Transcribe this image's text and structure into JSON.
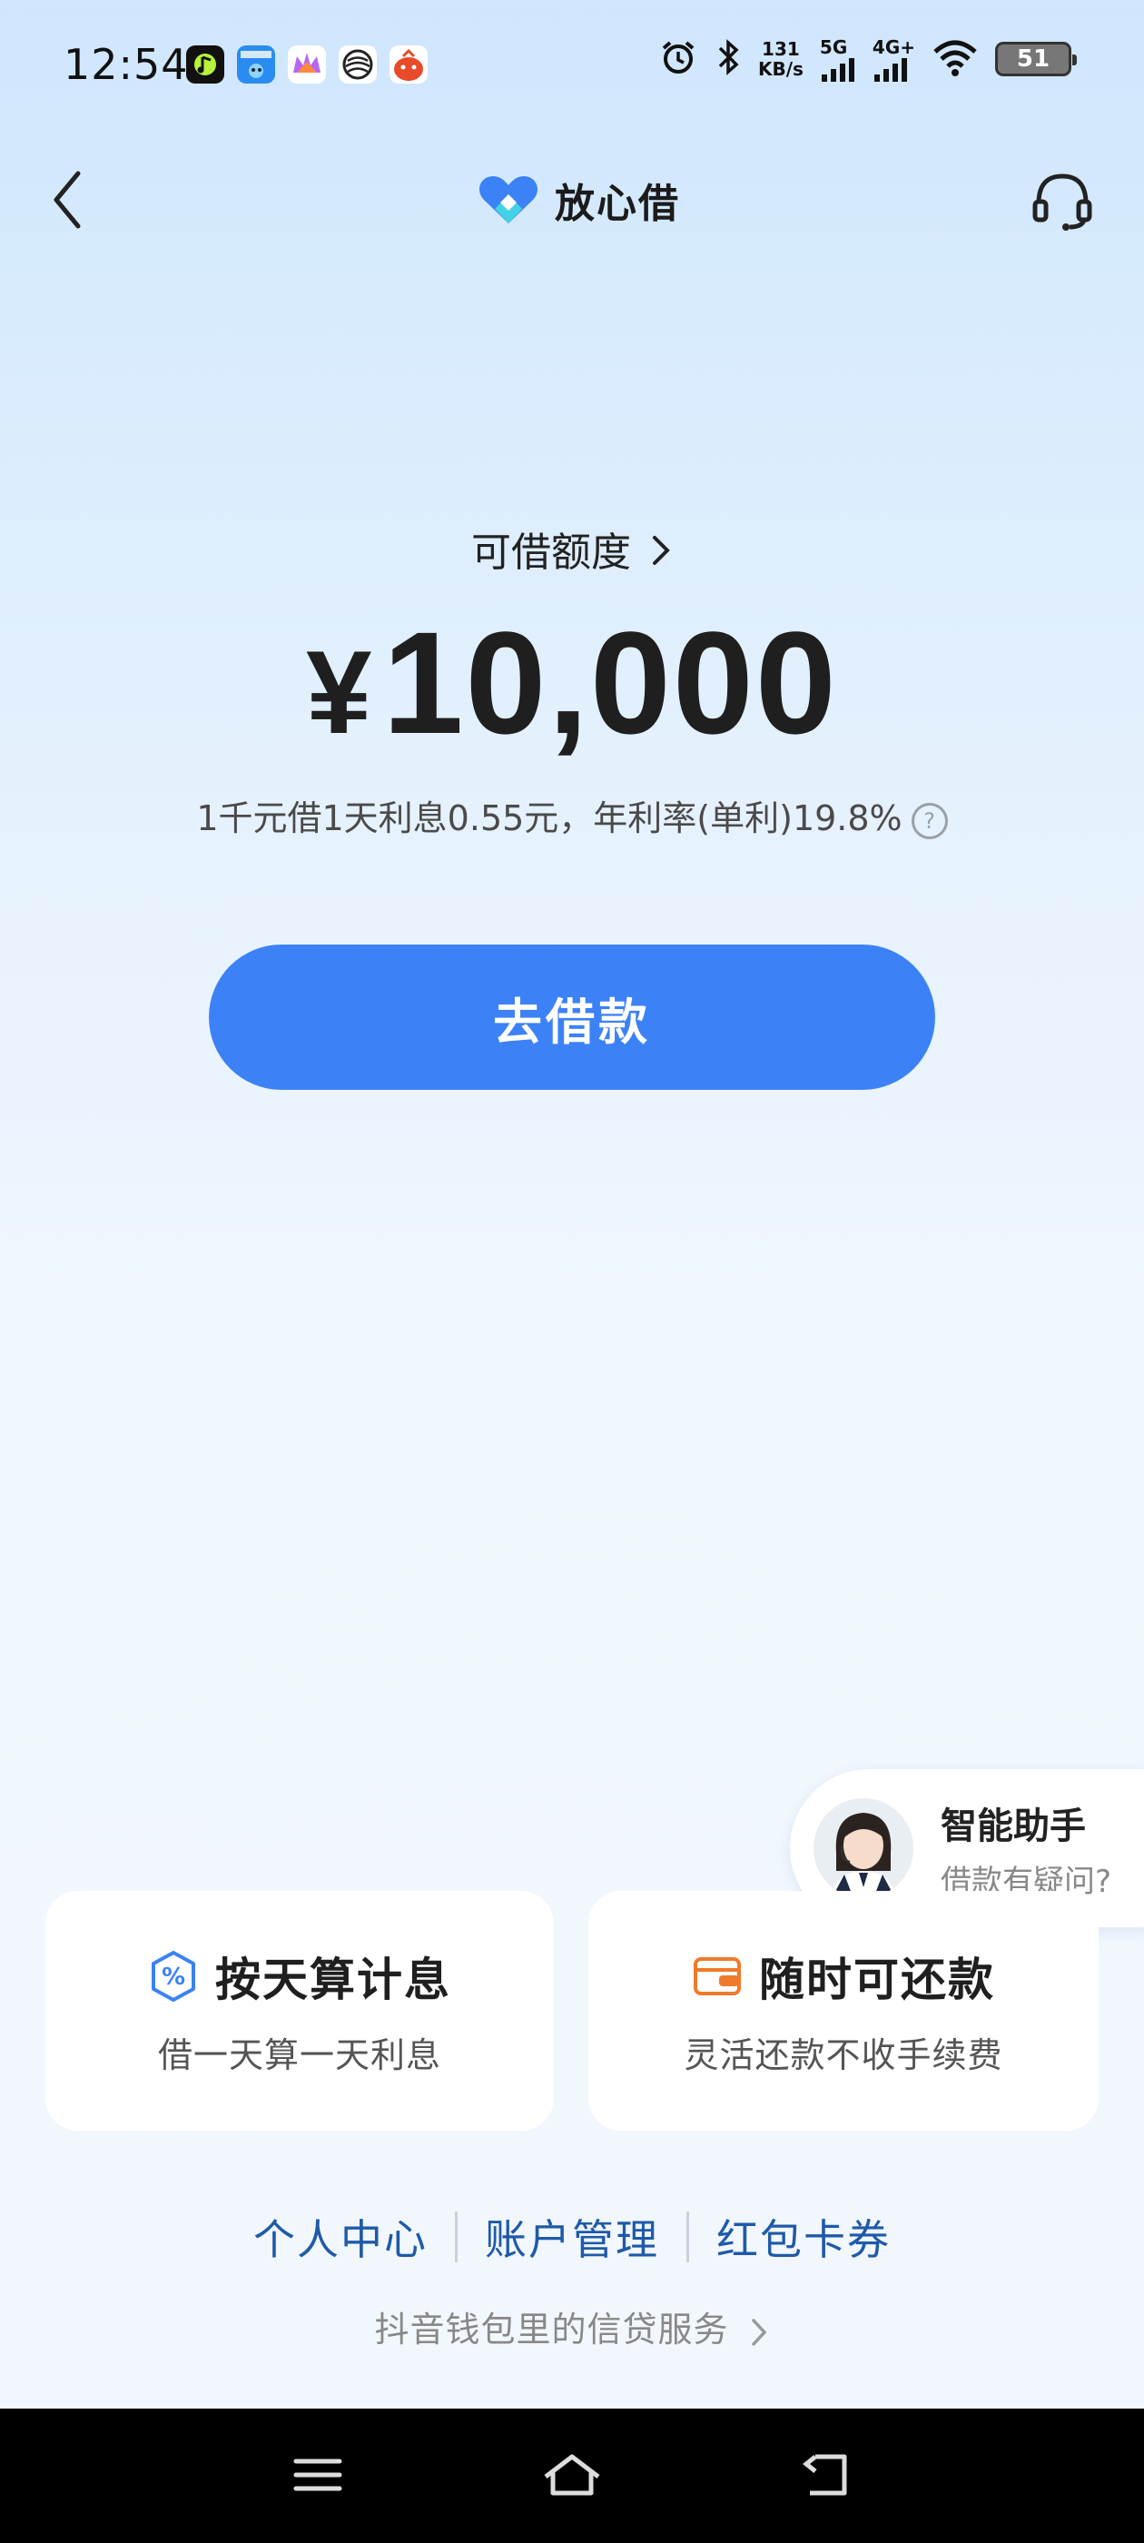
{
  "status_bar": {
    "time": "12:54",
    "net_speed_value": "131",
    "net_speed_unit": "KB/s",
    "sim1_label": "5G",
    "sim2_label": "4G+",
    "battery": "51",
    "app_icons": [
      "music-app-icon",
      "autohome-app-icon",
      "crown-app-icon",
      "mobile-carrier-icon",
      "red-app-icon"
    ],
    "sys_icons": [
      "alarm-icon",
      "bluetooth-icon",
      "signal-icon",
      "wifi-icon"
    ]
  },
  "header": {
    "brand": "放心借",
    "colors": {
      "logo_blue": "#3b82f6",
      "logo_cyan": "#43d1e6"
    }
  },
  "credit": {
    "title": "可借额度",
    "currency": "¥",
    "amount": "10,000",
    "rate_text": "1千元借1天利息0.55元，年利率(单利)19.8%",
    "help": "?"
  },
  "borrow_button": "去借款",
  "assistant": {
    "title": "智能助手",
    "subtitle": "借款有疑问?"
  },
  "features": [
    {
      "title": "按天算计息",
      "subtitle": "借一天算一天利息",
      "icon": "percent-icon",
      "color": "#3b82f6"
    },
    {
      "title": "随时可还款",
      "subtitle": "灵活还款不收手续费",
      "icon": "wallet-icon",
      "color": "#f07a2c"
    }
  ],
  "links": [
    "个人中心",
    "账户管理",
    "红包卡券"
  ],
  "wallet_service": "抖音钱包里的信贷服务",
  "colors": {
    "primary": "#3c82f6",
    "link": "#1e5aa8",
    "background_top": "#cfe6fd"
  }
}
